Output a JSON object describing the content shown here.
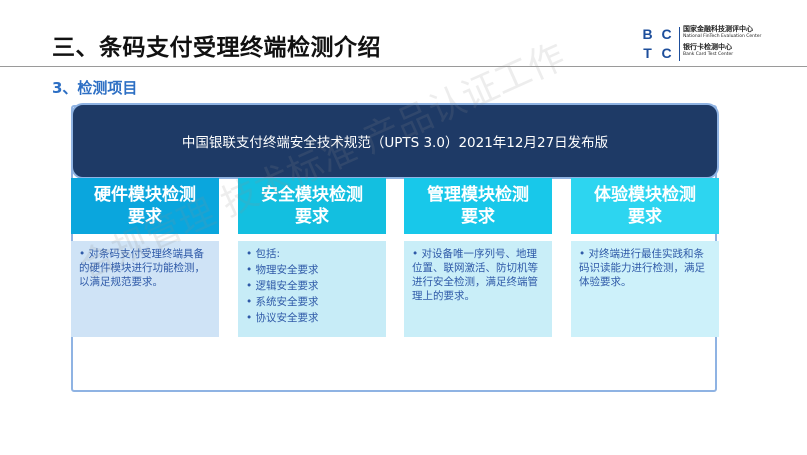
{
  "slide": {
    "title": "三、条码支付受理终端检测介绍",
    "section_heading": "3、检测项目"
  },
  "logo": {
    "mark_letters": [
      "B",
      "C",
      "T",
      "C"
    ],
    "org_cn": "国家金融科技测评中心",
    "org_en": "National FinTech Evaluation Center",
    "center_cn": "银行卡检测中心",
    "center_en": "Bank Card Test Center",
    "brand_color": "#1d4e9b"
  },
  "banner": {
    "text": "中国银联支付终端安全技术规范（UPTS 3.0）2021年12月27日发布版"
  },
  "columns": [
    {
      "header_line1": "硬件模块检测",
      "header_line2": "要求",
      "header_color": "#0aa6dd",
      "body_color": "#cfe3f6",
      "body": "• 对条码支付受理终端具备的硬件模块进行功能检测，以满足规范要求。"
    },
    {
      "header_line1": "安全模块检测",
      "header_line2": "要求",
      "header_color": "#13bfe0",
      "body_color": "#c7ecf7",
      "intro": "• 包括:",
      "items": [
        "物理安全要求",
        "逻辑安全要求",
        "系统安全要求",
        "协议安全要求"
      ]
    },
    {
      "header_line1": "管理模块检测",
      "header_line2": "要求",
      "header_color": "#18c8ea",
      "body_color": "#c9eef8",
      "body": "• 对设备唯一序列号、地理位置、联网激活、防切机等进行安全检测，满足终端管理上的要求。"
    },
    {
      "header_line1": "体验模块检测",
      "header_line2": "要求",
      "header_color": "#2dd5f0",
      "body_color": "#cdf1fa",
      "body": "• 对终端进行最佳实践和条码识读能力进行检测，满足体验要求。"
    }
  ],
  "watermark": {
    "text": "合规管理 技术标准 产品认证工作"
  }
}
